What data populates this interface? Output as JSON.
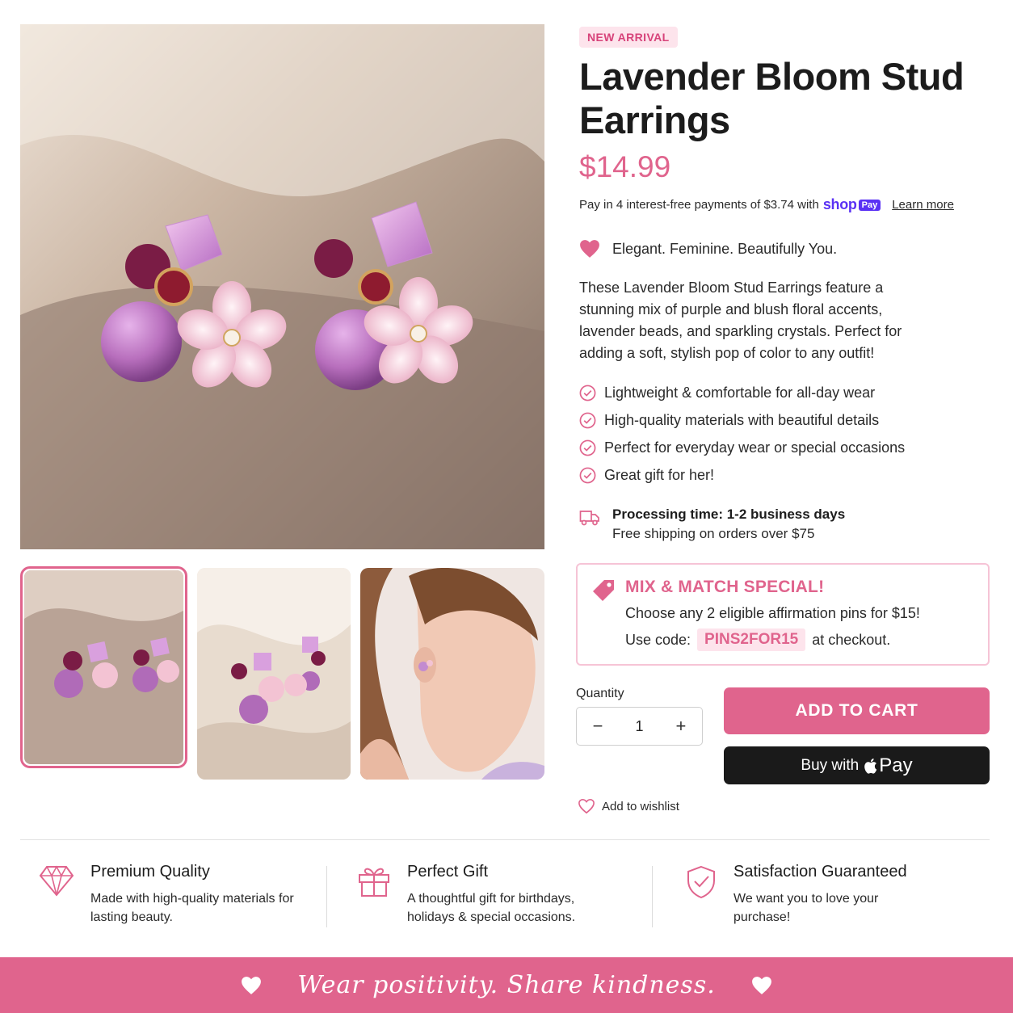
{
  "product": {
    "badge": "NEW ARRIVAL",
    "title": "Lavender Bloom Stud Earrings",
    "price": "$14.99",
    "installment_text": "Pay in 4 interest-free payments of $3.74 with",
    "shop_logo": "shop",
    "shop_pay_badge": "Pay",
    "learn_more": "Learn more",
    "tagline": "Elegant. Feminine. Beautifully You.",
    "description": "These Lavender Bloom Stud Earrings feature a stunning mix of purple and blush floral accents, lavender beads, and sparkling crystals. Perfect for adding a soft, stylish pop of color to any outfit!",
    "features": [
      "Lightweight & comfortable for all-day wear",
      "High-quality materials with beautiful details",
      "Perfect for everyday wear or special occasions",
      "Great gift for her!"
    ],
    "shipping_title": "Processing time: 1-2 business days",
    "shipping_sub": "Free shipping on orders over $75"
  },
  "promo": {
    "title": "MIX & MATCH SPECIAL!",
    "text": "Choose any 2 eligible affirmation pins for $15!",
    "code_prefix": "Use code:",
    "code": "PINS2FOR15",
    "code_suffix": "at checkout."
  },
  "purchase": {
    "quantity_label": "Quantity",
    "quantity_value": "1",
    "minus": "−",
    "plus": "+",
    "add_to_cart": "ADD TO CART",
    "buy_with": "Buy with",
    "pay_word": "Pay",
    "wishlist": "Add to wishlist"
  },
  "highlights": [
    {
      "icon": "diamond-icon",
      "title": "Premium Quality",
      "text": "Made with high-quality materials for lasting beauty."
    },
    {
      "icon": "gift-icon",
      "title": "Perfect Gift",
      "text": "A thoughtful gift for birthdays, holidays & special occasions."
    },
    {
      "icon": "shield-check-icon",
      "title": "Satisfaction Guaranteed",
      "text": "We want you to love your purchase!"
    }
  ],
  "footer": {
    "slogan": "Wear positivity. Share kindness."
  },
  "colors": {
    "accent": "#e0648d",
    "accent_light": "#fde4ec",
    "shop_pay": "#5a31f4",
    "dark_button": "#1a1a1a"
  }
}
